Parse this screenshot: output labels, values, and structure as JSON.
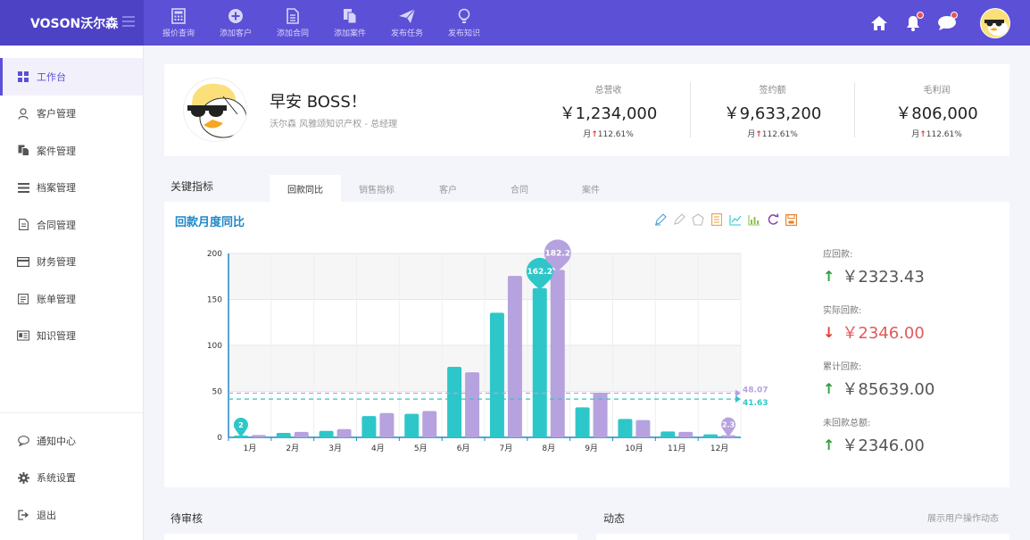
{
  "brand": {
    "name": "VOSON沃尔森"
  },
  "top_actions": [
    {
      "label": "报价查询",
      "icon": "calculator-icon"
    },
    {
      "label": "添加客户",
      "icon": "plus-circle-icon"
    },
    {
      "label": "添加合同",
      "icon": "document-icon"
    },
    {
      "label": "添加案件",
      "icon": "copy-icon"
    },
    {
      "label": "发布任务",
      "icon": "paper-plane-icon"
    },
    {
      "label": "发布知识",
      "icon": "lightbulb-icon"
    }
  ],
  "sidebar": {
    "items": [
      {
        "label": "工作台",
        "icon": "grid-icon",
        "active": true
      },
      {
        "label": "客户管理",
        "icon": "user-icon"
      },
      {
        "label": "案件管理",
        "icon": "copy-icon"
      },
      {
        "label": "档案管理",
        "icon": "list-icon"
      },
      {
        "label": "合同管理",
        "icon": "file-icon"
      },
      {
        "label": "财务管理",
        "icon": "card-icon"
      },
      {
        "label": "账单管理",
        "icon": "bill-icon"
      },
      {
        "label": "知识管理",
        "icon": "news-icon"
      }
    ],
    "bottom_items": [
      {
        "label": "通知中心",
        "icon": "chat-icon"
      },
      {
        "label": "系统设置",
        "icon": "gear-icon"
      },
      {
        "label": "退出",
        "icon": "logout-icon"
      }
    ]
  },
  "profile": {
    "greeting": "早安 BOSS！",
    "subline": "沃尔森 风雅颂知识产权 - 总经理"
  },
  "stats": [
    {
      "label": "总营收",
      "value": "￥1,234,000",
      "period": "月",
      "change": "112.61%"
    },
    {
      "label": "签约额",
      "value": "￥9,633,200",
      "period": "月",
      "change": "112.61%"
    },
    {
      "label": "毛利润",
      "value": "￥806,000",
      "period": "月",
      "change": "112.61%"
    }
  ],
  "kpi": {
    "title": "关键指标",
    "tabs": [
      "回款同比",
      "销售指标",
      "客户",
      "合同",
      "案件"
    ],
    "active_tab": 0
  },
  "chart_card": {
    "title": "回款月度同比",
    "toolbox_icons": [
      "pen-icon",
      "eraser-icon",
      "shape-icon",
      "data-view-icon",
      "line-chart-icon",
      "bar-chart-icon",
      "restore-icon",
      "save-icon"
    ]
  },
  "chart_data": {
    "type": "bar",
    "categories": [
      "1月",
      "2月",
      "3月",
      "4月",
      "5月",
      "6月",
      "7月",
      "8月",
      "9月",
      "10月",
      "11月",
      "12月"
    ],
    "series": [
      {
        "color": "#2ec7c9",
        "values": [
          2.0,
          4.9,
          7.0,
          23.2,
          25.6,
          76.7,
          135.6,
          162.2,
          32.6,
          20.0,
          6.4,
          3.3
        ],
        "max_label": "162.2",
        "min_label": "2",
        "mean_label": "41.63"
      },
      {
        "color": "#b6a2de",
        "values": [
          2.6,
          5.9,
          9.0,
          26.4,
          28.7,
          70.7,
          175.6,
          182.2,
          48.7,
          18.8,
          6.0,
          2.3
        ],
        "max_label": "182.2",
        "min_label": "2.3",
        "mean_label": "48.07"
      }
    ],
    "y_ticks": [
      "0",
      "50",
      "100",
      "150",
      "200"
    ],
    "ylim": [
      0,
      200
    ],
    "grid": true
  },
  "side_stats": [
    {
      "label": "应回款:",
      "value": "￥2323.43",
      "trend": "up"
    },
    {
      "label": "实际回款:",
      "value": "￥2346.00",
      "trend": "down"
    },
    {
      "label": "累计回款:",
      "value": "￥85639.00",
      "trend": "up"
    },
    {
      "label": "未回款总额:",
      "value": "￥2346.00",
      "trend": "up"
    }
  ],
  "bottom": {
    "left_title": "待审核",
    "right_title": "动态",
    "right_hint": "展示用户操作动态"
  },
  "colors": {
    "primary": "#5b50d6",
    "teal": "#2ec7c9",
    "purple": "#b6a2de",
    "up": "#2e9e3a",
    "down": "#e53935"
  }
}
